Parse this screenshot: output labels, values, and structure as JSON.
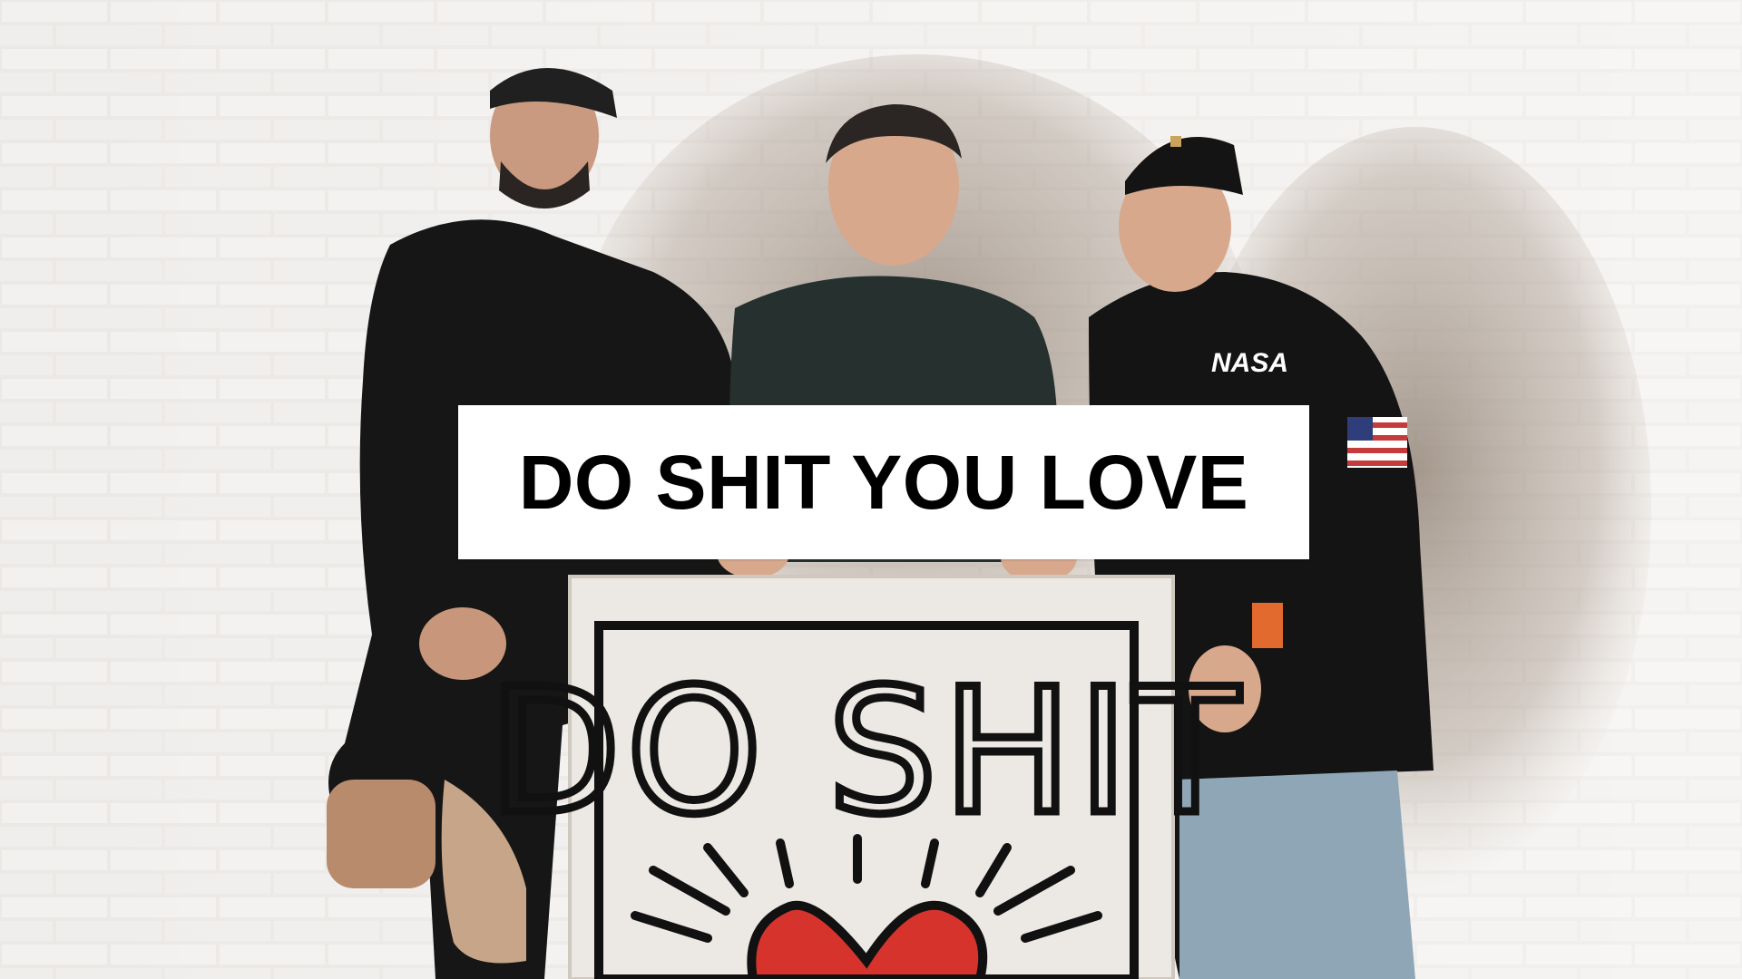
{
  "caption": {
    "text": "DO SHIT YOU LOVE"
  },
  "sign": {
    "text": "DO SHIT"
  },
  "shirt": {
    "logo_text": "NASA"
  },
  "colors": {
    "wall": "#e9e6e3",
    "clothing": "#141414",
    "caption_bg": "#ffffff",
    "caption_text": "#000000",
    "heart": "#d6332c"
  }
}
